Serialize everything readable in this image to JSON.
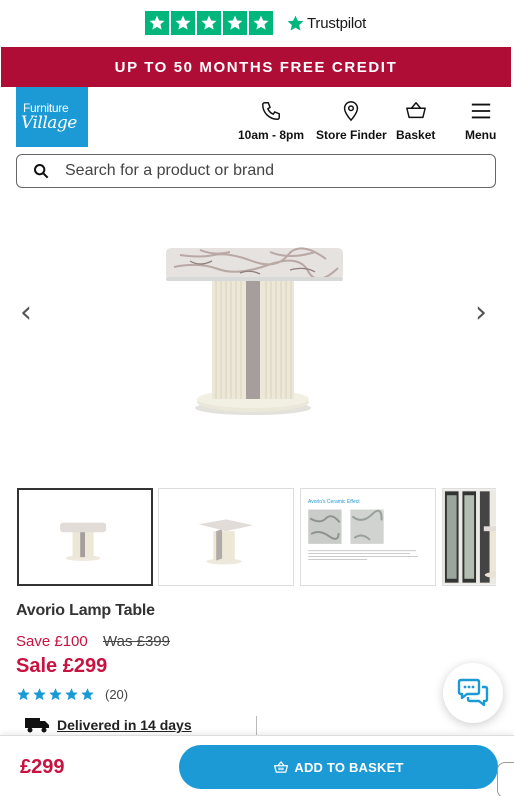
{
  "trustpilot": {
    "label": "Trustpilot",
    "rating_stars": 5
  },
  "promo": {
    "text": "UP TO 50 MONTHS FREE CREDIT"
  },
  "header": {
    "logo": {
      "line1": "Furniture",
      "line2": "Village"
    },
    "nav": [
      {
        "label": "10am - 8pm",
        "icon": "phone-icon"
      },
      {
        "label": "Store Finder",
        "icon": "location-pin-icon"
      },
      {
        "label": "Basket",
        "icon": "basket-icon"
      },
      {
        "label": "Menu",
        "icon": "hamburger-menu-icon"
      }
    ]
  },
  "search": {
    "placeholder": "Search for a product or brand"
  },
  "gallery": {
    "prev": "‹",
    "next": "›",
    "thumb3_title": "Avorio's Ceramic Effect"
  },
  "product": {
    "title": "Avorio Lamp Table",
    "save": "Save £100",
    "was": "Was £399",
    "sale": "Sale £299",
    "rating": 5,
    "review_count": "(20)",
    "delivery": "Delivered in 14 days"
  },
  "bottom_bar": {
    "price": "£299",
    "add_button": "ADD TO BASKET"
  },
  "colors": {
    "trustpilot_green": "#00b67a",
    "promo_red": "#b00d36",
    "brand_blue": "#1b9ad6",
    "sale_red": "#c8123f"
  }
}
